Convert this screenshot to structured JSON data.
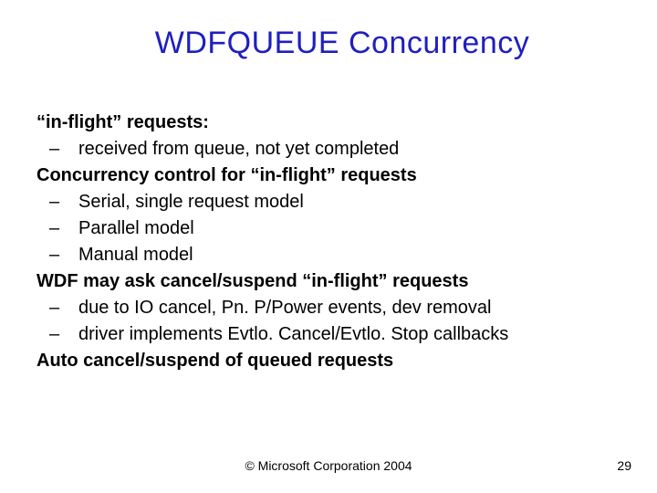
{
  "title": "WDFQUEUE Concurrency",
  "lines": {
    "l0": "“in-flight” requests:",
    "l1": "received from queue, not yet completed",
    "l2": "Concurrency control for “in-flight” requests",
    "l3": "Serial, single request model",
    "l4": "Parallel model",
    "l5": "Manual model",
    "l6": "WDF may ask cancel/suspend “in-flight” requests",
    "l7": "due to IO cancel, Pn. P/Power events, dev removal",
    "l8": "driver implements Evtlo. Cancel/Evtlo. Stop callbacks",
    "l9": "Auto cancel/suspend of queued requests"
  },
  "footer": "© Microsoft Corporation 2004",
  "page": "29"
}
